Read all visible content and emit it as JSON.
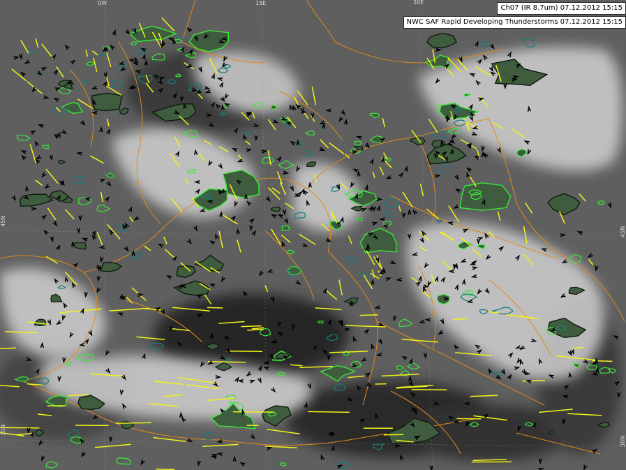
{
  "header": {
    "channel_label": "Ch07 (IR 8.7um)  07.12.2012 15:15",
    "product_label": "NWC SAF Rapid Developing Thunderstorms 07.12.2012 15:15"
  },
  "graticule": {
    "lon_labels": [
      "0W",
      "15E",
      "30E"
    ],
    "lat_labels_left": [
      "45N",
      "30N"
    ],
    "lat_labels_right": [
      "45N",
      "30N"
    ]
  },
  "legend_colors": {
    "background": "#5a5a5a",
    "cloud": "#d9d9d9",
    "borders": "#e08a1a",
    "cell_outline_bright": "#39e639",
    "cell_outline_dark": "#1a7a7a",
    "cell_fill": "#3f5c3f",
    "trajectory": "#f2f21a",
    "motion_arrow": "#000000"
  },
  "icons": {
    "motion_arrow": "arrow-icon",
    "thunderstorm_cell": "storm-cell-icon"
  }
}
